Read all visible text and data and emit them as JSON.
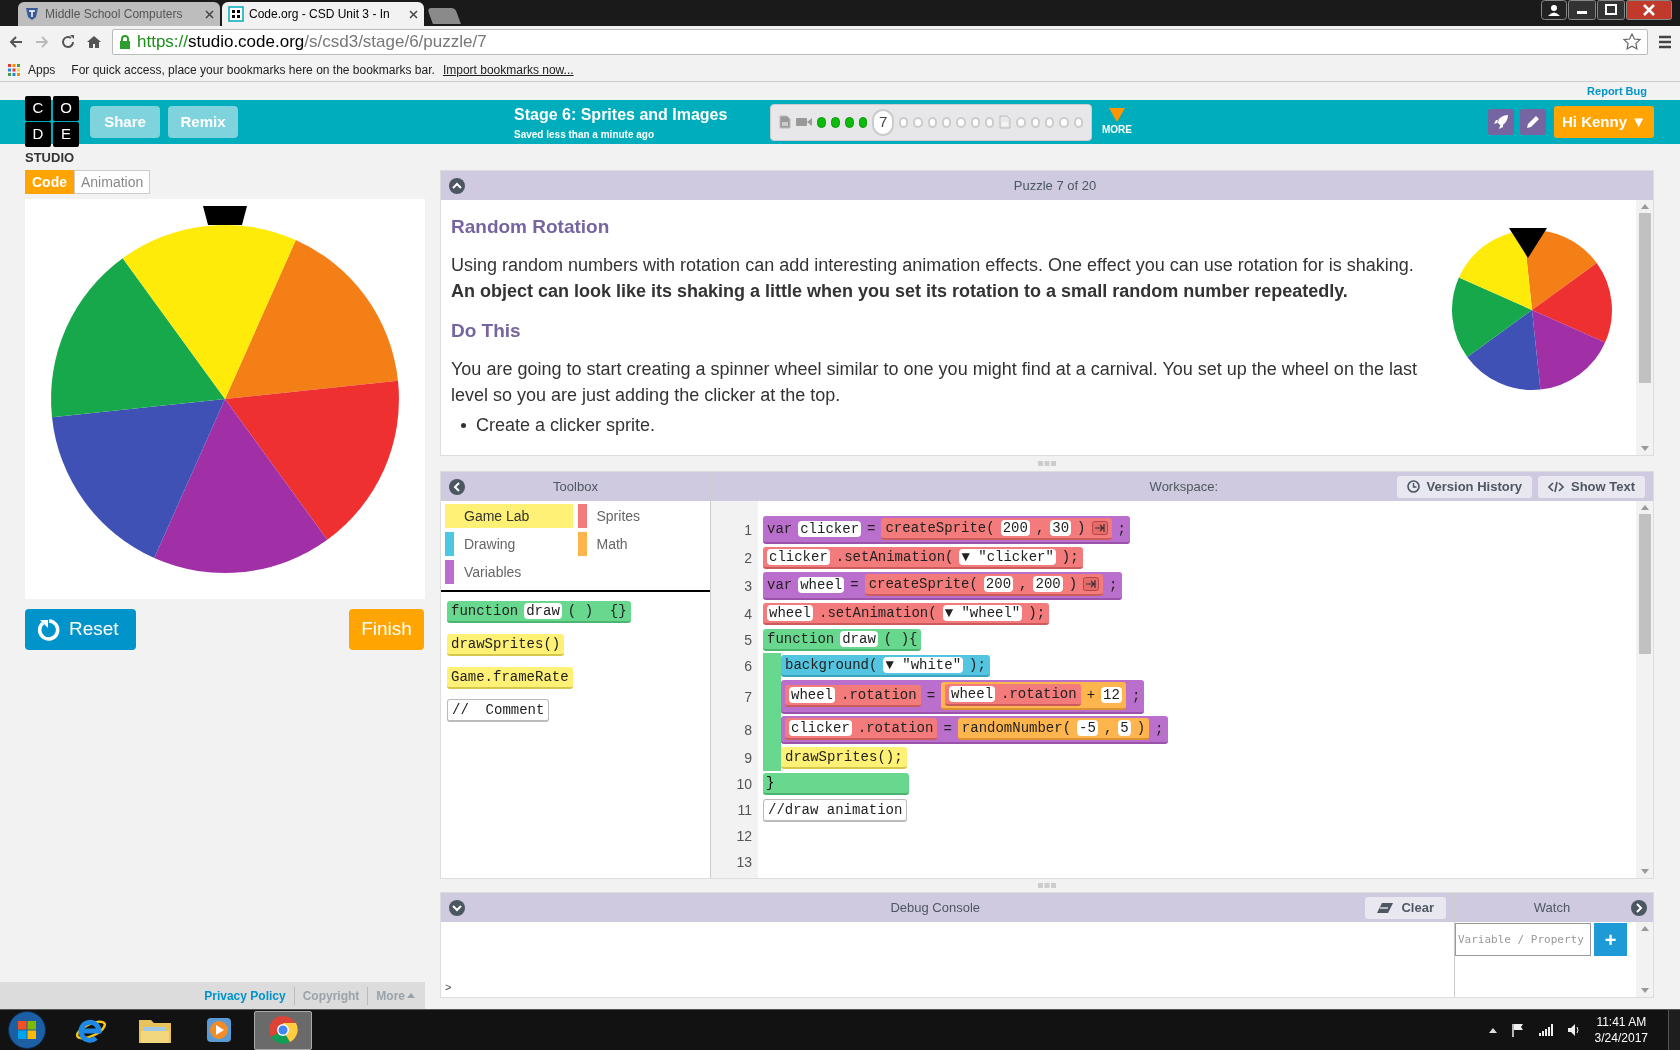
{
  "browser": {
    "tabs": [
      {
        "title": "Middle School Computers",
        "selected": false
      },
      {
        "title": "Code.org - CSD Unit 3 - In",
        "selected": true
      }
    ],
    "url": {
      "scheme": "https://",
      "host": "studio.code.org",
      "path": "/s/csd3/stage/6/puzzle/7"
    },
    "bookmarks_bar": {
      "apps": "Apps",
      "hint": "For quick access, place your bookmarks here on the bookmarks bar.",
      "import_link": "Import bookmarks now..."
    }
  },
  "report_bug": "Report Bug",
  "header": {
    "logo": [
      "C",
      "O",
      "D",
      "E"
    ],
    "logo_subtitle": "STUDIO",
    "buttons": [
      "Share",
      "Remix"
    ],
    "stage_title": "Stage 6: Sprites and Images",
    "save_status": "Saved less than a minute ago",
    "progress": [
      {
        "kind": "doc",
        "completed": true
      },
      {
        "kind": "video",
        "completed": true
      },
      {
        "kind": "level",
        "completed": true
      },
      {
        "kind": "level",
        "completed": true
      },
      {
        "kind": "level",
        "completed": true
      },
      {
        "kind": "level",
        "completed": true
      },
      {
        "kind": "current",
        "label": "7"
      },
      {
        "kind": "level",
        "completed": false
      },
      {
        "kind": "level",
        "completed": false
      },
      {
        "kind": "level",
        "completed": false
      },
      {
        "kind": "level",
        "completed": false
      },
      {
        "kind": "level",
        "completed": false
      },
      {
        "kind": "level",
        "completed": false
      },
      {
        "kind": "level",
        "completed": false
      },
      {
        "kind": "doc",
        "completed": false
      },
      {
        "kind": "level",
        "completed": false
      },
      {
        "kind": "level",
        "completed": false
      },
      {
        "kind": "level",
        "completed": false
      },
      {
        "kind": "level",
        "completed": false
      },
      {
        "kind": "level",
        "completed": false
      }
    ],
    "more": "MORE",
    "user_button": "Hi Kenny ▼"
  },
  "mode_tabs": [
    {
      "label": "Code",
      "selected": true
    },
    {
      "label": "Animation",
      "selected": false
    }
  ],
  "controls": {
    "reset": "Reset",
    "finish": "Finish"
  },
  "footer": {
    "links": [
      {
        "label": "Privacy Policy",
        "color": "#0094ca"
      },
      {
        "label": "Copyright",
        "color": "#9aa3a9"
      },
      {
        "label": "More",
        "color": "#9aa3a9"
      }
    ]
  },
  "instructions": {
    "header": "Puzzle 7 of 20",
    "title": "Random Rotation",
    "intro": "Using random numbers with rotation can add interesting animation effects. One effect you can use rotation for is shaking.",
    "emphasis": "An object can look like its shaking a little when you set its rotation to a small random number repeatedly.",
    "subheading": "Do This",
    "body": "You are going to start creating a spinner wheel similar to one you might find at a carnival. You set up the wheel on the last level so you are just adding the clicker at the top.",
    "bullets": [
      "Create a clicker sprite."
    ]
  },
  "toolbox": {
    "title": "Toolbox",
    "categories": [
      {
        "label": "Game Lab",
        "color": "#fff176",
        "selected": true
      },
      {
        "label": "Sprites",
        "color": "#f37b7b",
        "selected": false
      },
      {
        "label": "Drawing",
        "color": "#4dc8e0",
        "selected": false
      },
      {
        "label": "Math",
        "color": "#ffb54d",
        "selected": false
      },
      {
        "label": "Variables",
        "color": "#bb6fcc",
        "selected": false
      }
    ],
    "blocks": [
      {
        "kind": "function",
        "segments": [
          {
            "kind": "text",
            "text": "function"
          },
          {
            "kind": "slot",
            "text": "draw"
          },
          {
            "kind": "text",
            "text": "( )  {}"
          }
        ]
      },
      {
        "kind": "gamelab",
        "segments": [
          {
            "kind": "text",
            "text": "drawSprites()"
          }
        ]
      },
      {
        "kind": "gamelab",
        "segments": [
          {
            "kind": "text",
            "text": "Game.frameRate"
          }
        ]
      },
      {
        "kind": "comment",
        "segments": [
          {
            "kind": "text",
            "text": "//  Comment"
          }
        ]
      }
    ]
  },
  "workspace": {
    "title": "Workspace:",
    "buttons": [
      {
        "label": "Version History",
        "kind": "history"
      },
      {
        "label": "Show Text",
        "kind": "code"
      }
    ],
    "lines": [
      {
        "number": "1",
        "kind": "variables",
        "segments": [
          {
            "kind": "text",
            "text": "var"
          },
          {
            "kind": "slot",
            "text": "clicker"
          },
          {
            "kind": "text",
            "text": "="
          },
          {
            "kind": "sprites",
            "segments": [
              {
                "kind": "text",
                "text": "createSprite("
              },
              {
                "kind": "slot",
                "text": "200"
              },
              {
                "kind": "text",
                "text": ","
              },
              {
                "kind": "slot",
                "text": "30"
              },
              {
                "kind": "text",
                "text": ")"
              },
              {
                "kind": "expander"
              }
            ]
          },
          {
            "kind": "text",
            "text": ";"
          }
        ]
      },
      {
        "number": "2",
        "kind": "sprites",
        "segments": [
          {
            "kind": "slot",
            "text": "clicker"
          },
          {
            "kind": "text",
            "text": ".setAnimation("
          },
          {
            "kind": "slot",
            "text": "▼ \"clicker\""
          },
          {
            "kind": "text",
            "text": ");"
          }
        ]
      },
      {
        "number": "3",
        "kind": "variables",
        "segments": [
          {
            "kind": "text",
            "text": "var"
          },
          {
            "kind": "slot",
            "text": "wheel"
          },
          {
            "kind": "text",
            "text": "="
          },
          {
            "kind": "sprites",
            "segments": [
              {
                "kind": "text",
                "text": "createSprite("
              },
              {
                "kind": "slot",
                "text": "200"
              },
              {
                "kind": "text",
                "text": ","
              },
              {
                "kind": "slot",
                "text": "200"
              },
              {
                "kind": "text",
                "text": ")"
              },
              {
                "kind": "expander"
              }
            ]
          },
          {
            "kind": "text",
            "text": ";"
          }
        ]
      },
      {
        "number": "4",
        "kind": "sprites",
        "segments": [
          {
            "kind": "slot",
            "text": "wheel"
          },
          {
            "kind": "text",
            "text": ".setAnimation("
          },
          {
            "kind": "slot",
            "text": "▼ \"wheel\""
          },
          {
            "kind": "text",
            "text": ");"
          }
        ]
      },
      {
        "number": "5",
        "kind": "function",
        "segments": [
          {
            "kind": "text",
            "text": "function"
          },
          {
            "kind": "slot",
            "text": "draw"
          },
          {
            "kind": "text",
            "text": "( ){"
          }
        ],
        "children": [
          {
            "number": "6",
            "kind": "drawing",
            "segments": [
              {
                "kind": "text",
                "text": "background("
              },
              {
                "kind": "slot",
                "text": "▼ \"white\""
              },
              {
                "kind": "text",
                "text": ");"
              }
            ]
          },
          {
            "number": "7",
            "kind": "variables",
            "segments": [
              {
                "kind": "sprites",
                "segments": [
                  {
                    "kind": "slot",
                    "text": "wheel"
                  },
                  {
                    "kind": "text",
                    "text": ".rotation"
                  }
                ]
              },
              {
                "kind": "text",
                "text": "="
              },
              {
                "kind": "math",
                "segments": [
                  {
                    "kind": "sprites",
                    "segments": [
                      {
                        "kind": "slot",
                        "text": "wheel"
                      },
                      {
                        "kind": "text",
                        "text": ".rotation"
                      }
                    ]
                  },
                  {
                    "kind": "text",
                    "text": "+"
                  },
                  {
                    "kind": "slot",
                    "text": "12"
                  }
                ]
              },
              {
                "kind": "text",
                "text": ";"
              }
            ]
          },
          {
            "number": "8",
            "kind": "variables",
            "segments": [
              {
                "kind": "sprites",
                "segments": [
                  {
                    "kind": "slot",
                    "text": "clicker"
                  },
                  {
                    "kind": "text",
                    "text": ".rotation"
                  }
                ]
              },
              {
                "kind": "text",
                "text": "="
              },
              {
                "kind": "math",
                "segments": [
                  {
                    "kind": "text",
                    "text": "randomNumber("
                  },
                  {
                    "kind": "slot",
                    "text": "-5"
                  },
                  {
                    "kind": "text",
                    "text": ","
                  },
                  {
                    "kind": "slot",
                    "text": "5"
                  },
                  {
                    "kind": "text",
                    "text": ")"
                  }
                ]
              },
              {
                "kind": "text",
                "text": ";"
              }
            ]
          },
          {
            "number": "9",
            "kind": "gamelab",
            "segments": [
              {
                "kind": "text",
                "text": "drawSprites();"
              }
            ]
          }
        ],
        "closing": {
          "number": "10",
          "text": "}"
        }
      },
      {
        "number": "11",
        "kind": "comment",
        "segments": [
          {
            "kind": "text",
            "text": "//draw animation"
          }
        ]
      },
      {
        "number": "12"
      },
      {
        "number": "13"
      }
    ]
  },
  "debug": {
    "title": "Debug Console",
    "clear": "Clear",
    "prompt": ">"
  },
  "watch": {
    "title": "Watch",
    "placeholder": "Variable / Property",
    "add": "+"
  },
  "taskbar": {
    "apps": [
      {
        "kind": "ie",
        "selected": false
      },
      {
        "kind": "explorer",
        "selected": false
      },
      {
        "kind": "media",
        "selected": false
      },
      {
        "kind": "chrome",
        "selected": true
      }
    ],
    "time": "11:41 AM",
    "date": "3/24/2017"
  }
}
